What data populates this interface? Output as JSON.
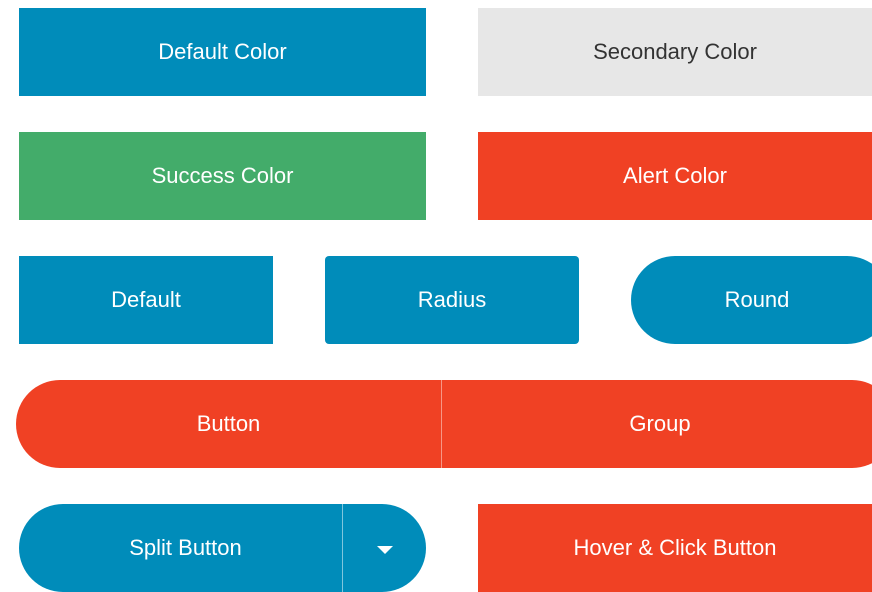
{
  "colors": {
    "primary": "#008cba",
    "secondary": "#e7e7e7",
    "success": "#43ac6a",
    "alert": "#f04124"
  },
  "row1": {
    "default_color": "Default Color",
    "secondary_color": "Secondary Color"
  },
  "row2": {
    "success_color": "Success Color",
    "alert_color": "Alert Color"
  },
  "row3": {
    "default": "Default",
    "radius": "Radius",
    "round": "Round"
  },
  "button_group": {
    "left": "Button",
    "right": "Group"
  },
  "split_button": {
    "label": "Split Button",
    "toggle_icon": "caret-down-icon"
  },
  "hover_click": {
    "label": "Hover & Click Button"
  }
}
